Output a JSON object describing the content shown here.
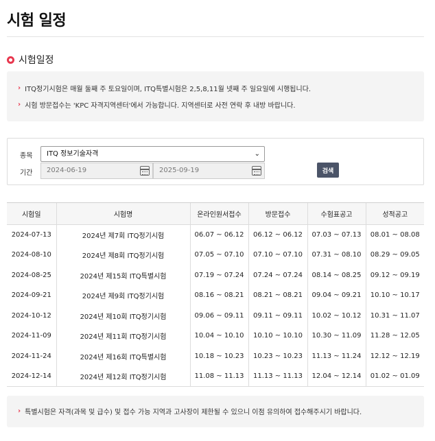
{
  "page": {
    "title": "시험 일정"
  },
  "section": {
    "title": "시험일정"
  },
  "notices": [
    "ITQ정기시험은 매월 둘째 주 토요일이며, ITQ특별시험은 2,5,8,11월 넷째 주 일요일에 시행됩니다.",
    "시험 방문접수는 'KPC 자격지역센터'에서 가능합니다. 지역센터로 사전 연락 후 내방 바랍니다."
  ],
  "filter": {
    "category_label": "종목",
    "category_value": "ITQ 정보기술자격",
    "period_label": "기간",
    "date_from": "2024-06-19",
    "date_to": "2025-09-19",
    "search_label": "검색"
  },
  "table": {
    "headers": [
      "시험일",
      "시험명",
      "온라인원서접수",
      "방문접수",
      "수험표공고",
      "성적공고"
    ],
    "rows": [
      [
        "2024-07-13",
        "2024년 제7회 ITQ정기시험",
        "06.07 ~ 06.12",
        "06.12 ~ 06.12",
        "07.03 ~ 07.13",
        "08.01 ~ 08.08"
      ],
      [
        "2024-08-10",
        "2024년 제8회 ITQ정기시험",
        "07.05 ~ 07.10",
        "07.10 ~ 07.10",
        "07.31 ~ 08.10",
        "08.29 ~ 09.05"
      ],
      [
        "2024-08-25",
        "2024년 제15회 ITQ특별시험",
        "07.19 ~ 07.24",
        "07.24 ~ 07.24",
        "08.14 ~ 08.25",
        "09.12 ~ 09.19"
      ],
      [
        "2024-09-21",
        "2024년 제9회 ITQ정기시험",
        "08.16 ~ 08.21",
        "08.21 ~ 08.21",
        "09.04 ~ 09.21",
        "10.10 ~ 10.17"
      ],
      [
        "2024-10-12",
        "2024년 제10회 ITQ정기시험",
        "09.06 ~ 09.11",
        "09.11 ~ 09.11",
        "10.02 ~ 10.12",
        "10.31 ~ 11.07"
      ],
      [
        "2024-11-09",
        "2024년 제11회 ITQ정기시험",
        "10.04 ~ 10.10",
        "10.10 ~ 10.10",
        "10.30 ~ 11.09",
        "11.28 ~ 12.05"
      ],
      [
        "2024-11-24",
        "2024년 제16회 ITQ특별시험",
        "10.18 ~ 10.23",
        "10.23 ~ 10.23",
        "11.13 ~ 11.24",
        "12.12 ~ 12.19"
      ],
      [
        "2024-12-14",
        "2024년 제12회 ITQ정기시험",
        "11.08 ~ 11.13",
        "11.13 ~ 11.13",
        "12.04 ~ 12.14",
        "01.02 ~ 01.09"
      ]
    ]
  },
  "footnote": "특별시험은 자격(과목 및 급수) 및 접수 가능 지역과 고사장이 제한될 수 있으니 이점 유의하여 접수해주시기 바랍니다.",
  "colors": {
    "accent": "#e8374e",
    "button": "#4b5468",
    "notice_bg": "#f4f4f4"
  },
  "icons": {
    "section": "ring-icon",
    "bullet": "chevron-right-icon",
    "date": "calendar-icon",
    "select": "chevron-down-icon"
  }
}
